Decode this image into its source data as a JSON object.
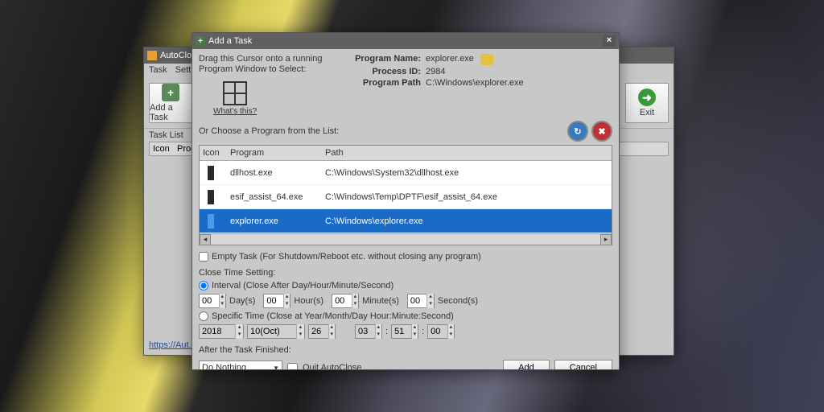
{
  "main_window": {
    "title": "AutoClose",
    "menu": [
      "Task",
      "Setting"
    ],
    "toolbar": {
      "add": "Add a Task",
      "exit": "Exit"
    },
    "tasklist_label": "Task List",
    "columns": [
      "Icon",
      "Prog"
    ],
    "status_url": "https://Aut..."
  },
  "modal": {
    "title": "Add a Task",
    "drag_hint": "Drag this Cursor onto a running Program Window to Select:",
    "whats_this": "What's this?",
    "program_name_lbl": "Program Name:",
    "program_name": "explorer.exe",
    "process_id_lbl": "Process ID:",
    "process_id": "2984",
    "program_path_lbl": "Program Path",
    "program_path": "C:\\Windows\\explorer.exe",
    "choose_label": "Or Choose a Program from the List:",
    "list_columns": {
      "icon": "Icon",
      "program": "Program",
      "path": "Path"
    },
    "list": [
      {
        "program": "dllhost.exe",
        "path": "C:\\Windows\\System32\\dllhost.exe",
        "selected": false
      },
      {
        "program": "esif_assist_64.exe",
        "path": "C:\\Windows\\Temp\\DPTF\\esif_assist_64.exe",
        "selected": false
      },
      {
        "program": "explorer.exe",
        "path": "C:\\Windows\\explorer.exe",
        "selected": true
      }
    ],
    "empty_task": "Empty Task (For Shutdown/Reboot etc. without closing any program)",
    "close_time_title": "Close Time Setting:",
    "interval_label": "Interval (Close After Day/Hour/Minute/Second)",
    "interval": {
      "day": "00",
      "day_u": "Day(s)",
      "hour": "00",
      "hour_u": "Hour(s)",
      "minute": "00",
      "minute_u": "Minute(s)",
      "second": "00",
      "second_u": "Second(s)"
    },
    "specific_label": "Specific Time (Close at Year/Month/Day Hour:Minute:Second)",
    "specific": {
      "year": "2018",
      "month": "10(Oct)",
      "day": "26",
      "hour": "03",
      "minute": "51",
      "second": "00"
    },
    "after_title": "After the Task Finished:",
    "after_value": "Do Nothing",
    "quit_label": "Quit AutoClose",
    "add_btn": "Add",
    "cancel_btn": "Cancel"
  }
}
